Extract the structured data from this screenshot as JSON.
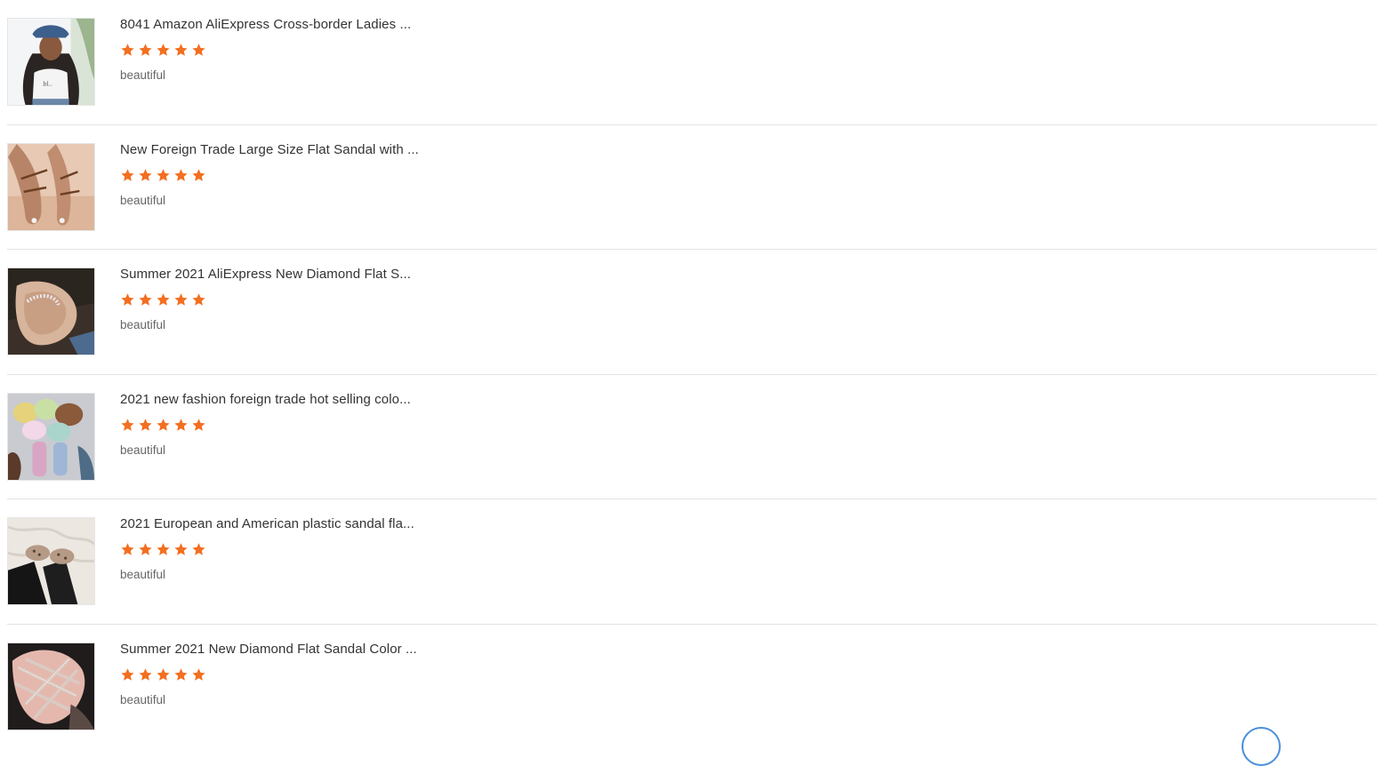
{
  "colors": {
    "star": "#f36f21",
    "divider": "#e2e2e2",
    "title_text": "#333333",
    "comment_text": "#666666",
    "widget_border": "#4a90d9"
  },
  "reviews": [
    {
      "title": "8041 Amazon AliExpress Cross-border Ladies ...",
      "rating": 5,
      "comment": "beautiful",
      "thumbnail": "woman-in-white-tshirt-and-denim-hat-photo"
    },
    {
      "title": "New Foreign Trade Large Size Flat Sandal with ...",
      "rating": 5,
      "comment": "beautiful",
      "thumbnail": "feet-in-brown-strappy-sandals-photo"
    },
    {
      "title": "Summer 2021 AliExpress New Diamond Flat S...",
      "rating": 5,
      "comment": "beautiful",
      "thumbnail": "foot-in-rhinestone-flat-sandal-photo"
    },
    {
      "title": "2021 new fashion foreign trade hot selling colo...",
      "rating": 5,
      "comment": "beautiful",
      "thumbnail": "colorful-fur-slides-photo"
    },
    {
      "title": "2021 European and American plastic sandal fla...",
      "rating": 5,
      "comment": "beautiful",
      "thumbnail": "studded-plastic-sandals-on-rug-photo"
    },
    {
      "title": "Summer 2021 New Diamond Flat Sandal Color ...",
      "rating": 5,
      "comment": "beautiful",
      "thumbnail": "foot-in-crossed-diamond-sandal-photo"
    }
  ],
  "floating_widget": {
    "icon": "chat-bubble-icon"
  }
}
